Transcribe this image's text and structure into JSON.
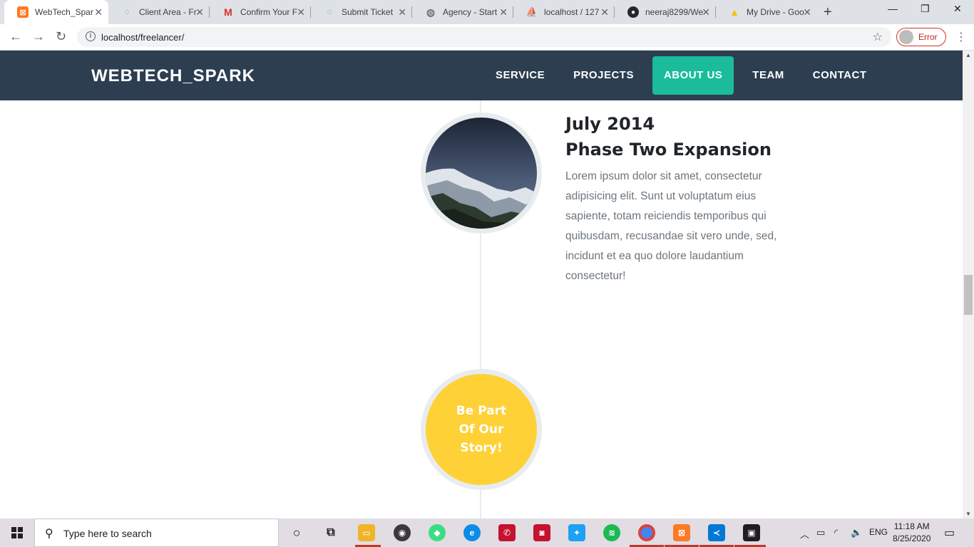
{
  "browser": {
    "tabs": [
      {
        "title": "WebTech_Spar",
        "icon": "xampp-icon",
        "active": true
      },
      {
        "title": "Client Area - Fr",
        "icon": "spinner-icon"
      },
      {
        "title": "Confirm Your F",
        "icon": "gmail-icon"
      },
      {
        "title": "Submit Ticket",
        "icon": "spinner-icon"
      },
      {
        "title": "Agency - Start",
        "icon": "globe-icon"
      },
      {
        "title": "localhost / 127",
        "icon": "phpmyadmin-icon"
      },
      {
        "title": "neeraj8299/We",
        "icon": "github-icon"
      },
      {
        "title": "My Drive - Goo",
        "icon": "drive-icon"
      }
    ],
    "url": "localhost/freelancer/",
    "profile_status": "Error"
  },
  "site": {
    "brand": "WEBTECH_SPARK",
    "menu": [
      "SERVICE",
      "PROJECTS",
      "ABOUT US",
      "TEAM",
      "CONTACT"
    ],
    "active_menu": "ABOUT US",
    "colors": {
      "nav_bg": "#2c3e50",
      "accent": "#1abc9c",
      "story": "#fed136"
    },
    "timeline": {
      "date": "July 2014",
      "title": "Phase Two Expansion",
      "body": "Lorem ipsum dolor sit amet, consectetur adipisicing elit. Sunt ut voluptatum eius sapiente, totam reiciendis temporibus qui quibusdam, recusandae sit vero unde, sed, incidunt et ea quo dolore laudantium consectetur!",
      "image": "mountain-photo"
    },
    "story_cta": "Be Part Of Our Story!"
  },
  "taskbar": {
    "search_placeholder": "Type here to search",
    "language": "ENG",
    "time": "11:18 AM",
    "date": "8/25/2020"
  }
}
